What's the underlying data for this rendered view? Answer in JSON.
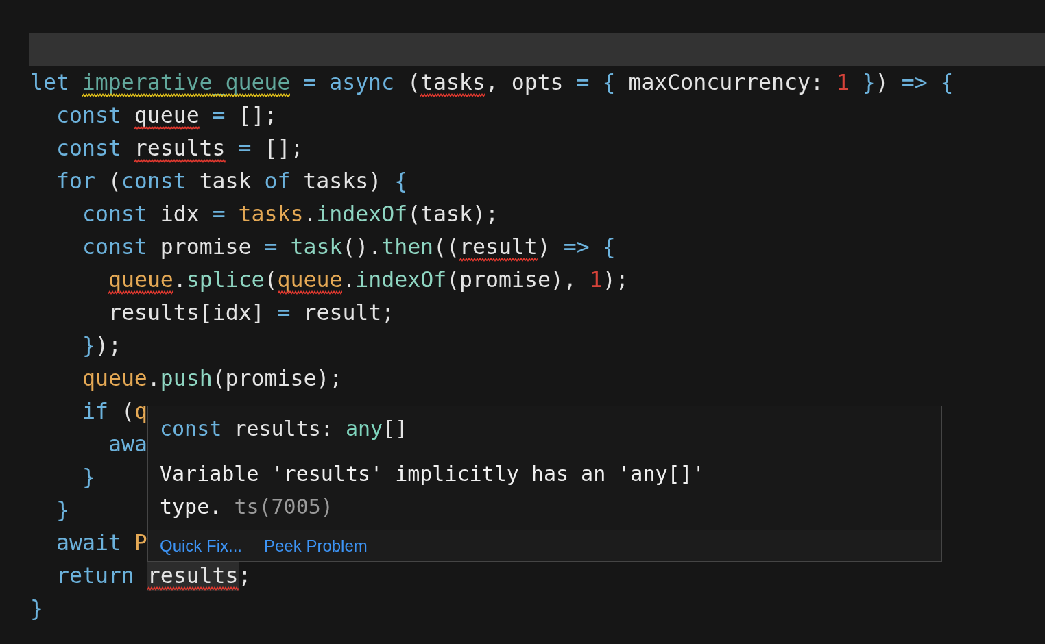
{
  "editor": {
    "lines": [
      {
        "tokens": [
          {
            "text": "let ",
            "kind": "keyword"
          },
          {
            "text": "imperative_queue",
            "kind": "declared",
            "warning": true
          },
          {
            "text": " = ",
            "kind": "operator"
          },
          {
            "text": "async",
            "kind": "keyword"
          },
          {
            "text": " (",
            "kind": "plain"
          },
          {
            "text": "tasks",
            "kind": "plain",
            "error": true
          },
          {
            "text": ", opts ",
            "kind": "plain"
          },
          {
            "text": "= { ",
            "kind": "operator"
          },
          {
            "text": "maxConcurrency: ",
            "kind": "plain"
          },
          {
            "text": "1",
            "kind": "number"
          },
          {
            "text": " }",
            "kind": "operator"
          },
          {
            "text": ") ",
            "kind": "plain"
          },
          {
            "text": "=> {",
            "kind": "operator"
          }
        ],
        "children": [
          {
            "tokens": [
              {
                "text": "const ",
                "kind": "keyword"
              },
              {
                "text": "queue",
                "kind": "plain",
                "error": true
              },
              {
                "text": " = ",
                "kind": "operator"
              },
              {
                "text": "[];",
                "kind": "plain"
              }
            ]
          },
          {
            "tokens": [
              {
                "text": "const ",
                "kind": "keyword"
              },
              {
                "text": "results",
                "kind": "plain",
                "error": true
              },
              {
                "text": " = ",
                "kind": "operator"
              },
              {
                "text": "[];",
                "kind": "plain"
              }
            ]
          },
          {
            "tokens": [
              {
                "text": "for ",
                "kind": "keyword"
              },
              {
                "text": "(",
                "kind": "plain"
              },
              {
                "text": "const ",
                "kind": "keyword"
              },
              {
                "text": "task ",
                "kind": "plain"
              },
              {
                "text": "of ",
                "kind": "keyword"
              },
              {
                "text": "tasks) ",
                "kind": "plain"
              },
              {
                "text": "{",
                "kind": "operator"
              }
            ],
            "children": [
              {
                "tokens": [
                  {
                    "text": "const ",
                    "kind": "keyword"
                  },
                  {
                    "text": "idx ",
                    "kind": "plain"
                  },
                  {
                    "text": "= ",
                    "kind": "operator"
                  },
                  {
                    "text": "tasks",
                    "kind": "variable"
                  },
                  {
                    "text": ".",
                    "kind": "plain"
                  },
                  {
                    "text": "indexOf",
                    "kind": "function"
                  },
                  {
                    "text": "(task);",
                    "kind": "plain"
                  }
                ]
              },
              {
                "tokens": [
                  {
                    "text": "const ",
                    "kind": "keyword"
                  },
                  {
                    "text": "promise ",
                    "kind": "plain"
                  },
                  {
                    "text": "= ",
                    "kind": "operator"
                  },
                  {
                    "text": "task",
                    "kind": "function"
                  },
                  {
                    "text": "().",
                    "kind": "plain"
                  },
                  {
                    "text": "then",
                    "kind": "function"
                  },
                  {
                    "text": "((",
                    "kind": "plain"
                  },
                  {
                    "text": "result",
                    "kind": "plain",
                    "error": true
                  },
                  {
                    "text": ") ",
                    "kind": "plain"
                  },
                  {
                    "text": "=> {",
                    "kind": "operator"
                  }
                ],
                "children": [
                  {
                    "tokens": [
                      {
                        "text": "queue",
                        "kind": "variable",
                        "error": true
                      },
                      {
                        "text": ".",
                        "kind": "plain"
                      },
                      {
                        "text": "splice",
                        "kind": "function"
                      },
                      {
                        "text": "(",
                        "kind": "plain"
                      },
                      {
                        "text": "queue",
                        "kind": "variable",
                        "error": true
                      },
                      {
                        "text": ".",
                        "kind": "plain"
                      },
                      {
                        "text": "indexOf",
                        "kind": "function"
                      },
                      {
                        "text": "(promise), ",
                        "kind": "plain"
                      },
                      {
                        "text": "1",
                        "kind": "number"
                      },
                      {
                        "text": ");",
                        "kind": "plain"
                      }
                    ]
                  },
                  {
                    "tokens": [
                      {
                        "text": "results[idx] ",
                        "kind": "plain"
                      },
                      {
                        "text": "= ",
                        "kind": "operator"
                      },
                      {
                        "text": "result;",
                        "kind": "plain"
                      }
                    ]
                  }
                ]
              },
              {
                "tokens": [
                  {
                    "text": "}",
                    "kind": "operator"
                  },
                  {
                    "text": ");",
                    "kind": "plain"
                  }
                ]
              },
              {
                "tokens": [
                  {
                    "text": "queue",
                    "kind": "variable"
                  },
                  {
                    "text": ".",
                    "kind": "plain"
                  },
                  {
                    "text": "push",
                    "kind": "function"
                  },
                  {
                    "text": "(promise);",
                    "kind": "plain"
                  }
                ]
              },
              {
                "tokens": [
                  {
                    "text": "if ",
                    "kind": "keyword"
                  },
                  {
                    "text": "(",
                    "kind": "plain"
                  },
                  {
                    "text": "q",
                    "kind": "variable"
                  }
                ],
                "children": [
                  {
                    "tokens": [
                      {
                        "text": "awa",
                        "kind": "keyword"
                      }
                    ]
                  }
                ]
              },
              {
                "tokens": [
                  {
                    "text": "}",
                    "kind": "operator"
                  }
                ]
              }
            ]
          },
          {
            "tokens": [
              {
                "text": "}",
                "kind": "operator"
              }
            ]
          },
          {
            "tokens": [
              {
                "text": "await ",
                "kind": "keyword"
              },
              {
                "text": "P",
                "kind": "variable"
              }
            ]
          },
          {
            "tokens": [
              {
                "text": "return ",
                "kind": "keyword"
              },
              {
                "text": "results",
                "kind": "plain",
                "error": true,
                "hovered": true
              },
              {
                "text": ";",
                "kind": "plain"
              }
            ]
          }
        ]
      },
      {
        "tokens": [
          {
            "text": "}",
            "kind": "operator"
          }
        ]
      }
    ]
  },
  "hover": {
    "signature": [
      {
        "text": "const ",
        "kind": "keyword"
      },
      {
        "text": "results: ",
        "kind": "plain"
      },
      {
        "text": "any",
        "kind": "type"
      },
      {
        "text": "[]",
        "kind": "plain"
      }
    ],
    "message": "Variable 'results' implicitly has an 'any[]' type.",
    "code": "ts(7005)",
    "actions": [
      "Quick Fix...",
      "Peek Problem"
    ]
  }
}
